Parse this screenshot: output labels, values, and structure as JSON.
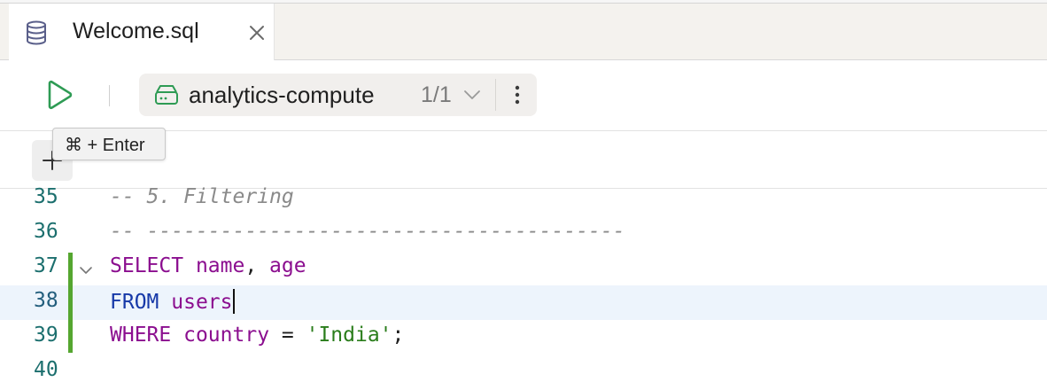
{
  "tab": {
    "label": "Welcome.sql"
  },
  "toolbar": {
    "datasource_name": "analytics-compute",
    "datasource_count": "1/1"
  },
  "tooltip": {
    "text": "⌘ + Enter"
  },
  "add_button": {
    "symbol": "+"
  },
  "editor": {
    "lines": [
      {
        "number": "35",
        "tokens": [
          {
            "t": "-- 5. Filtering",
            "c": "comment"
          }
        ]
      },
      {
        "number": "36",
        "tokens": [
          {
            "t": "-- ---------------------------------------",
            "c": "comment"
          }
        ]
      },
      {
        "number": "37",
        "tokens": [
          {
            "t": "SELECT",
            "c": "kw-select"
          },
          {
            "t": " ",
            "c": "punc"
          },
          {
            "t": "name",
            "c": "ident"
          },
          {
            "t": ", ",
            "c": "punc"
          },
          {
            "t": "age",
            "c": "ident"
          }
        ]
      },
      {
        "number": "38",
        "tokens": [
          {
            "t": "FROM",
            "c": "kw-blue"
          },
          {
            "t": " ",
            "c": "punc"
          },
          {
            "t": "users",
            "c": "ident"
          }
        ]
      },
      {
        "number": "39",
        "tokens": [
          {
            "t": "WHERE",
            "c": "kw-select"
          },
          {
            "t": " ",
            "c": "punc"
          },
          {
            "t": "country",
            "c": "ident"
          },
          {
            "t": " = ",
            "c": "punc"
          },
          {
            "t": "'India'",
            "c": "str"
          },
          {
            "t": ";",
            "c": "punc"
          }
        ]
      },
      {
        "number": "40",
        "tokens": []
      }
    ]
  },
  "colors": {
    "run_green": "#2e9b54",
    "change_marker": "#55a630",
    "current_line": "#edf4fc"
  }
}
